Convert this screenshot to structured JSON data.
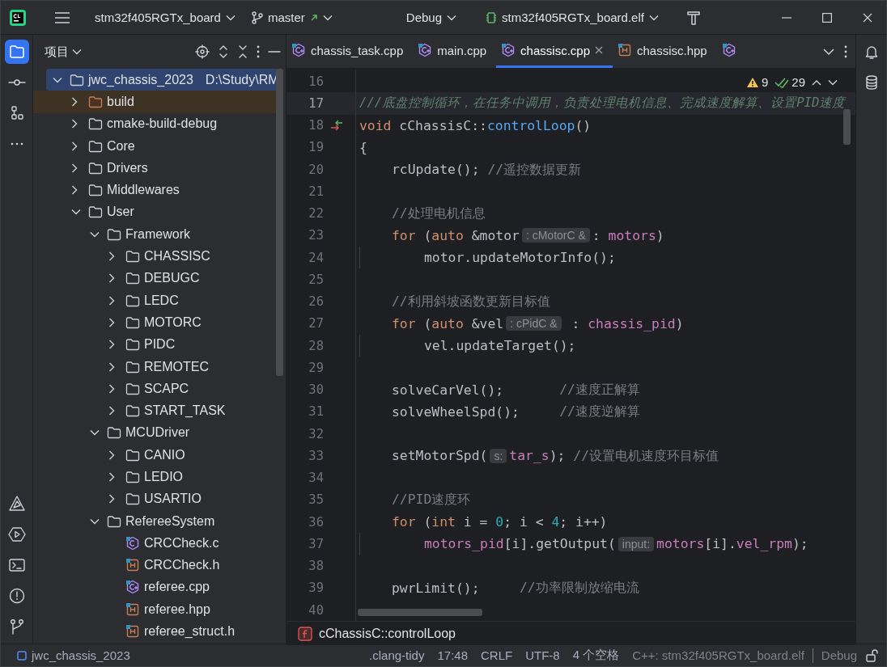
{
  "title_bar": {
    "project": "stm32f405RGTx_board",
    "branch": "master",
    "configuration": "Debug",
    "target": "stm32f405RGTx_board.elf"
  },
  "left_toolbar": [
    {
      "kind": "project",
      "selected": true
    },
    {
      "kind": "commit",
      "selected": false
    },
    {
      "kind": "structure",
      "selected": false
    },
    {
      "kind": "more",
      "selected": false
    }
  ],
  "left_toolbar_bottom": [
    {
      "kind": "cmake"
    },
    {
      "kind": "services"
    },
    {
      "kind": "terminal"
    },
    {
      "kind": "problems"
    },
    {
      "kind": "git"
    }
  ],
  "project_panel": {
    "title": "项目",
    "tree": [
      {
        "name": "jwc_chassis_2023",
        "path": "D:\\Study\\RM",
        "kind": "folder",
        "expanded": true,
        "selected": true,
        "excluded": false,
        "children": [
          {
            "name": "build",
            "kind": "folder",
            "expanded": false,
            "selected": false,
            "excluded": true
          },
          {
            "name": "cmake-build-debug",
            "kind": "folder",
            "expanded": false,
            "selected": false,
            "excluded": false
          },
          {
            "name": "Core",
            "kind": "folder",
            "expanded": false,
            "selected": false,
            "excluded": false
          },
          {
            "name": "Drivers",
            "kind": "folder",
            "expanded": false,
            "selected": false,
            "excluded": false
          },
          {
            "name": "Middlewares",
            "kind": "folder",
            "expanded": false,
            "selected": false,
            "excluded": false
          },
          {
            "name": "User",
            "kind": "folder",
            "expanded": true,
            "selected": false,
            "excluded": false,
            "children": [
              {
                "name": "Framework",
                "kind": "folder",
                "expanded": true,
                "selected": false,
                "excluded": false,
                "children": [
                  {
                    "name": "CHASSISC",
                    "kind": "folder",
                    "expanded": false,
                    "selected": false,
                    "excluded": false
                  },
                  {
                    "name": "DEBUGC",
                    "kind": "folder",
                    "expanded": false,
                    "selected": false,
                    "excluded": false
                  },
                  {
                    "name": "LEDC",
                    "kind": "folder",
                    "expanded": false,
                    "selected": false,
                    "excluded": false
                  },
                  {
                    "name": "MOTORC",
                    "kind": "folder",
                    "expanded": false,
                    "selected": false,
                    "excluded": false
                  },
                  {
                    "name": "PIDC",
                    "kind": "folder",
                    "expanded": false,
                    "selected": false,
                    "excluded": false
                  },
                  {
                    "name": "REMOTEC",
                    "kind": "folder",
                    "expanded": false,
                    "selected": false,
                    "excluded": false
                  },
                  {
                    "name": "SCAPC",
                    "kind": "folder",
                    "expanded": false,
                    "selected": false,
                    "excluded": false
                  },
                  {
                    "name": "START_TASK",
                    "kind": "folder",
                    "expanded": false,
                    "selected": false,
                    "excluded": false
                  }
                ]
              },
              {
                "name": "MCUDriver",
                "kind": "folder",
                "expanded": true,
                "selected": false,
                "excluded": false,
                "children": [
                  {
                    "name": "CANIO",
                    "kind": "folder",
                    "expanded": false,
                    "selected": false,
                    "excluded": false
                  },
                  {
                    "name": "LEDIO",
                    "kind": "folder",
                    "expanded": false,
                    "selected": false,
                    "excluded": false
                  },
                  {
                    "name": "USARTIO",
                    "kind": "folder",
                    "expanded": false,
                    "selected": false,
                    "excluded": false
                  }
                ]
              },
              {
                "name": "RefereeSystem",
                "kind": "folder",
                "expanded": true,
                "selected": false,
                "excluded": false,
                "children": [
                  {
                    "name": "CRCCheck.c",
                    "kind": "c",
                    "selected": false,
                    "excluded": false
                  },
                  {
                    "name": "CRCCheck.h",
                    "kind": "h",
                    "selected": false,
                    "excluded": false
                  },
                  {
                    "name": "referee.cpp",
                    "kind": "cpp",
                    "selected": false,
                    "excluded": false
                  },
                  {
                    "name": "referee.hpp",
                    "kind": "h",
                    "selected": false,
                    "excluded": false
                  },
                  {
                    "name": "referee_struct.h",
                    "kind": "h",
                    "selected": false,
                    "excluded": false
                  }
                ]
              }
            ]
          }
        ]
      }
    ]
  },
  "tabs": [
    {
      "label": "chassis_task.cpp",
      "kind": "cpp",
      "selected": false
    },
    {
      "label": "main.cpp",
      "kind": "cpp",
      "selected": false
    },
    {
      "label": "chassisc.cpp",
      "kind": "cpp",
      "selected": true
    },
    {
      "label": "chassisc.hpp",
      "kind": "h",
      "selected": false
    },
    {
      "kind": "cpp",
      "selected": false
    }
  ],
  "inspections": {
    "warnings": "9",
    "weak_warnings": "29"
  },
  "lines": [
    {
      "n": "16",
      "current": false,
      "override": false
    },
    {
      "n": "17",
      "current": true,
      "override": false,
      "kind": "outer",
      "parts": [
        {
          "kind": "doc",
          "text": "///底盘控制循环，在任务中调用，负责处理电机信息、完成速度解算、设置PID速度"
        }
      ]
    },
    {
      "n": "18",
      "current": false,
      "override": true,
      "kind": "outer",
      "parts": [
        {
          "kind": "code",
          "tokens": [
            {
              "text": "void",
              "kind": "kw"
            },
            {
              "text": " cChassisC::",
              "kind": "plain"
            },
            {
              "text": "controlLoop",
              "kind": "fn"
            },
            {
              "text": "()",
              "kind": "plain"
            }
          ]
        }
      ]
    },
    {
      "n": "19",
      "current": false,
      "override": false,
      "kind": "outer",
      "parts": [
        {
          "kind": "code",
          "tokens": [
            {
              "text": "{",
              "kind": "plain"
            }
          ]
        }
      ]
    },
    {
      "n": "20",
      "current": false,
      "override": false,
      "kind": "body",
      "parts": [
        {
          "kind": "code",
          "tokens": [
            {
              "text": "rcUpdate(); ",
              "kind": "plain"
            }
          ]
        },
        {
          "kind": "comment",
          "text": "//遥控数据更新"
        }
      ]
    },
    {
      "n": "21",
      "current": false,
      "override": false
    },
    {
      "n": "22",
      "current": false,
      "override": false,
      "kind": "body",
      "parts": [
        {
          "kind": "comment",
          "text": "//处理电机信息"
        }
      ]
    },
    {
      "n": "23",
      "current": false,
      "override": false,
      "kind": "body",
      "parts": [
        {
          "kind": "code",
          "tokens": [
            {
              "text": "for",
              "kind": "kw"
            },
            {
              "text": " (",
              "kind": "plain"
            },
            {
              "text": "auto",
              "kind": "kw"
            },
            {
              "text": " &motor",
              "kind": "plain"
            }
          ]
        },
        {
          "kind": "hint",
          "text": ": cMotorC &"
        },
        {
          "kind": "code",
          "tokens": [
            {
              "text": ": ",
              "kind": "plain"
            },
            {
              "text": "motors",
              "kind": "field"
            },
            {
              "text": ")",
              "kind": "plain"
            }
          ]
        }
      ]
    },
    {
      "n": "24",
      "current": false,
      "override": false,
      "kind": "nested",
      "parts": [
        {
          "kind": "code",
          "tokens": [
            {
              "text": "motor.updateMotorInfo();",
              "kind": "plain"
            }
          ]
        }
      ]
    },
    {
      "n": "25",
      "current": false,
      "override": false
    },
    {
      "n": "26",
      "current": false,
      "override": false,
      "kind": "body",
      "parts": [
        {
          "kind": "comment",
          "text": "//利用斜坡函数更新目标值"
        }
      ]
    },
    {
      "n": "27",
      "current": false,
      "override": false,
      "kind": "body",
      "parts": [
        {
          "kind": "code",
          "tokens": [
            {
              "text": "for",
              "kind": "kw"
            },
            {
              "text": " (",
              "kind": "plain"
            },
            {
              "text": "auto",
              "kind": "kw"
            },
            {
              "text": " &vel",
              "kind": "plain"
            }
          ]
        },
        {
          "kind": "hint",
          "text": ": cPidC &"
        },
        {
          "kind": "code",
          "tokens": [
            {
              "text": " : ",
              "kind": "plain"
            },
            {
              "text": "chassis_pid",
              "kind": "field"
            },
            {
              "text": ")",
              "kind": "plain"
            }
          ]
        }
      ]
    },
    {
      "n": "28",
      "current": false,
      "override": false,
      "kind": "nested",
      "parts": [
        {
          "kind": "code",
          "tokens": [
            {
              "text": "vel.updateTarget();",
              "kind": "plain"
            }
          ]
        }
      ]
    },
    {
      "n": "29",
      "current": false,
      "override": false
    },
    {
      "n": "30",
      "current": false,
      "override": false,
      "kind": "body",
      "parts": [
        {
          "kind": "code",
          "tokens": [
            {
              "text": "solveCarVel();       ",
              "kind": "plain"
            }
          ]
        },
        {
          "kind": "comment",
          "text": "//速度正解算"
        }
      ]
    },
    {
      "n": "31",
      "current": false,
      "override": false,
      "kind": "body",
      "parts": [
        {
          "kind": "code",
          "tokens": [
            {
              "text": "solveWheelSpd();     ",
              "kind": "plain"
            }
          ]
        },
        {
          "kind": "comment",
          "text": "//速度逆解算"
        }
      ]
    },
    {
      "n": "32",
      "current": false,
      "override": false
    },
    {
      "n": "33",
      "current": false,
      "override": false,
      "kind": "body",
      "parts": [
        {
          "kind": "code",
          "tokens": [
            {
              "text": "setMotorSpd(",
              "kind": "plain"
            }
          ]
        },
        {
          "kind": "hint",
          "text": "s:"
        },
        {
          "kind": "code",
          "tokens": [
            {
              "text": "tar_s",
              "kind": "field"
            },
            {
              "text": "); ",
              "kind": "plain"
            }
          ]
        },
        {
          "kind": "comment",
          "text": "//设置电机速度环目标值"
        }
      ]
    },
    {
      "n": "34",
      "current": false,
      "override": false
    },
    {
      "n": "35",
      "current": false,
      "override": false,
      "kind": "body",
      "parts": [
        {
          "kind": "comment",
          "text": "//PID速度环"
        }
      ]
    },
    {
      "n": "36",
      "current": false,
      "override": false,
      "kind": "body",
      "parts": [
        {
          "kind": "code",
          "tokens": [
            {
              "text": "for",
              "kind": "kw"
            },
            {
              "text": " (",
              "kind": "plain"
            },
            {
              "text": "int",
              "kind": "kw"
            },
            {
              "text": " i = ",
              "kind": "plain"
            },
            {
              "text": "0",
              "kind": "num"
            },
            {
              "text": "; i < ",
              "kind": "plain"
            },
            {
              "text": "4",
              "kind": "num"
            },
            {
              "text": "; i++)",
              "kind": "plain"
            }
          ]
        }
      ]
    },
    {
      "n": "37",
      "current": false,
      "override": false,
      "kind": "nested",
      "parts": [
        {
          "kind": "code",
          "tokens": [
            {
              "text": "motors_pid",
              "kind": "field"
            },
            {
              "text": "[i].getOutput(",
              "kind": "plain"
            }
          ]
        },
        {
          "kind": "hint",
          "text": "input:"
        },
        {
          "kind": "code",
          "tokens": [
            {
              "text": "motors",
              "kind": "field"
            },
            {
              "text": "[i].",
              "kind": "plain"
            },
            {
              "text": "vel_rpm",
              "kind": "field"
            },
            {
              "text": ");",
              "kind": "plain"
            }
          ]
        }
      ]
    },
    {
      "n": "38",
      "current": false,
      "override": false
    },
    {
      "n": "39",
      "current": false,
      "override": false,
      "kind": "body",
      "parts": [
        {
          "kind": "code",
          "tokens": [
            {
              "text": "pwrLimit();     ",
              "kind": "plain"
            }
          ]
        },
        {
          "kind": "comment",
          "text": "//功率限制放缩电流"
        }
      ]
    },
    {
      "n": "40",
      "current": false,
      "override": false
    }
  ],
  "breadcrumb": {
    "kind": "function",
    "text": "cChassisC::controlLoop"
  },
  "status_bar": {
    "project": "jwc_chassis_2023",
    "items": [
      ".clang-tidy",
      "17:48",
      "CRLF",
      "UTF-8",
      "4 个空格"
    ],
    "context": "C++: stm32f405RGTx_board.elf",
    "profile": "Debug"
  }
}
